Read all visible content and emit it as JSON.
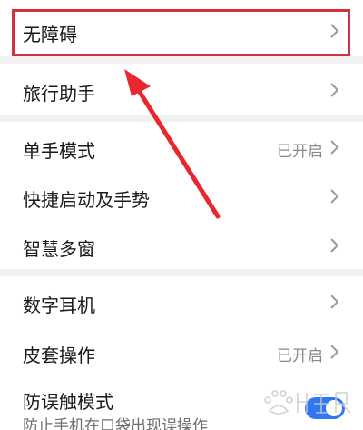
{
  "settings": {
    "items": [
      {
        "label": "无障碍"
      },
      {
        "label": "旅行助手"
      },
      {
        "label": "单手模式",
        "status": "已开启"
      },
      {
        "label": "快捷启动及手势"
      },
      {
        "label": "智慧多窗"
      },
      {
        "label": "数字耳机"
      },
      {
        "label": "皮套操作",
        "status": "已开启"
      },
      {
        "label": "防误触模式",
        "subtitle": "防止手机在口袋出现误操作",
        "toggle_on": true
      }
    ]
  },
  "colors": {
    "highlight_box": "#d3313f",
    "arrow": "#e8282e",
    "toggle_on": "#2f78f0"
  },
  "icons": {
    "chevron": "chevron-right-icon",
    "watermark": "baidu-jingyan-watermark-logo"
  }
}
